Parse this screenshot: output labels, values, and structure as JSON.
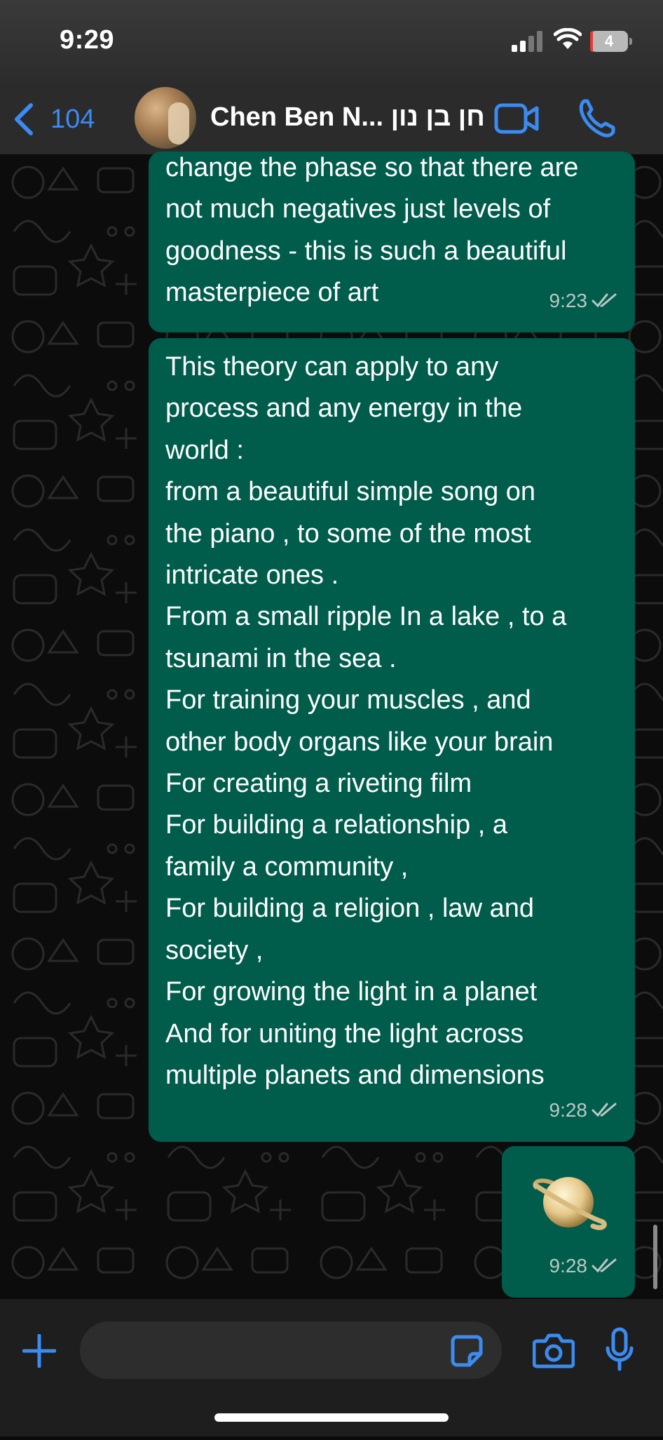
{
  "status_bar": {
    "time": "9:29",
    "battery": "4",
    "icons": [
      "signal-icon",
      "wifi-icon",
      "battery-icon"
    ]
  },
  "header": {
    "back_count": "104",
    "contact_name": "Chen Ben N... חן בן נון",
    "icons": [
      "back-chevron-icon",
      "avatar",
      "video-call-icon",
      "phone-call-icon"
    ]
  },
  "messages": [
    {
      "text": "change the phase so that there are\nnot much negatives just levels of\ngoodness - this is such a beautiful\nmasterpiece of art",
      "time": "9:23",
      "status": "double-check-icon"
    },
    {
      "text": "This theory can apply to any\nprocess and any energy in the\nworld :\nfrom a beautiful simple song on\nthe piano , to some of the most\nintricate ones .\nFrom a small ripple In a lake , to a\ntsunami in the sea .\nFor training your muscles , and\nother body organs like your brain\nFor creating a riveting film\nFor building a relationship , a\nfamily a community ,\nFor building a religion , law and\nsociety ,\nFor growing the light in a planet\nAnd for uniting the light across\nmultiple planets and dimensions",
      "time": "9:28",
      "status": "double-check-icon"
    },
    {
      "emoji": "saturn-emoji",
      "time": "9:28",
      "status": "double-check-icon"
    }
  ],
  "input_bar": {
    "placeholder": "",
    "icons": [
      "plus-icon",
      "sticker-icon",
      "camera-icon",
      "microphone-icon"
    ]
  },
  "colors": {
    "accent": "#3b8bf0",
    "bubble_outgoing": "#005c4b",
    "background": "#0b0b0b"
  }
}
